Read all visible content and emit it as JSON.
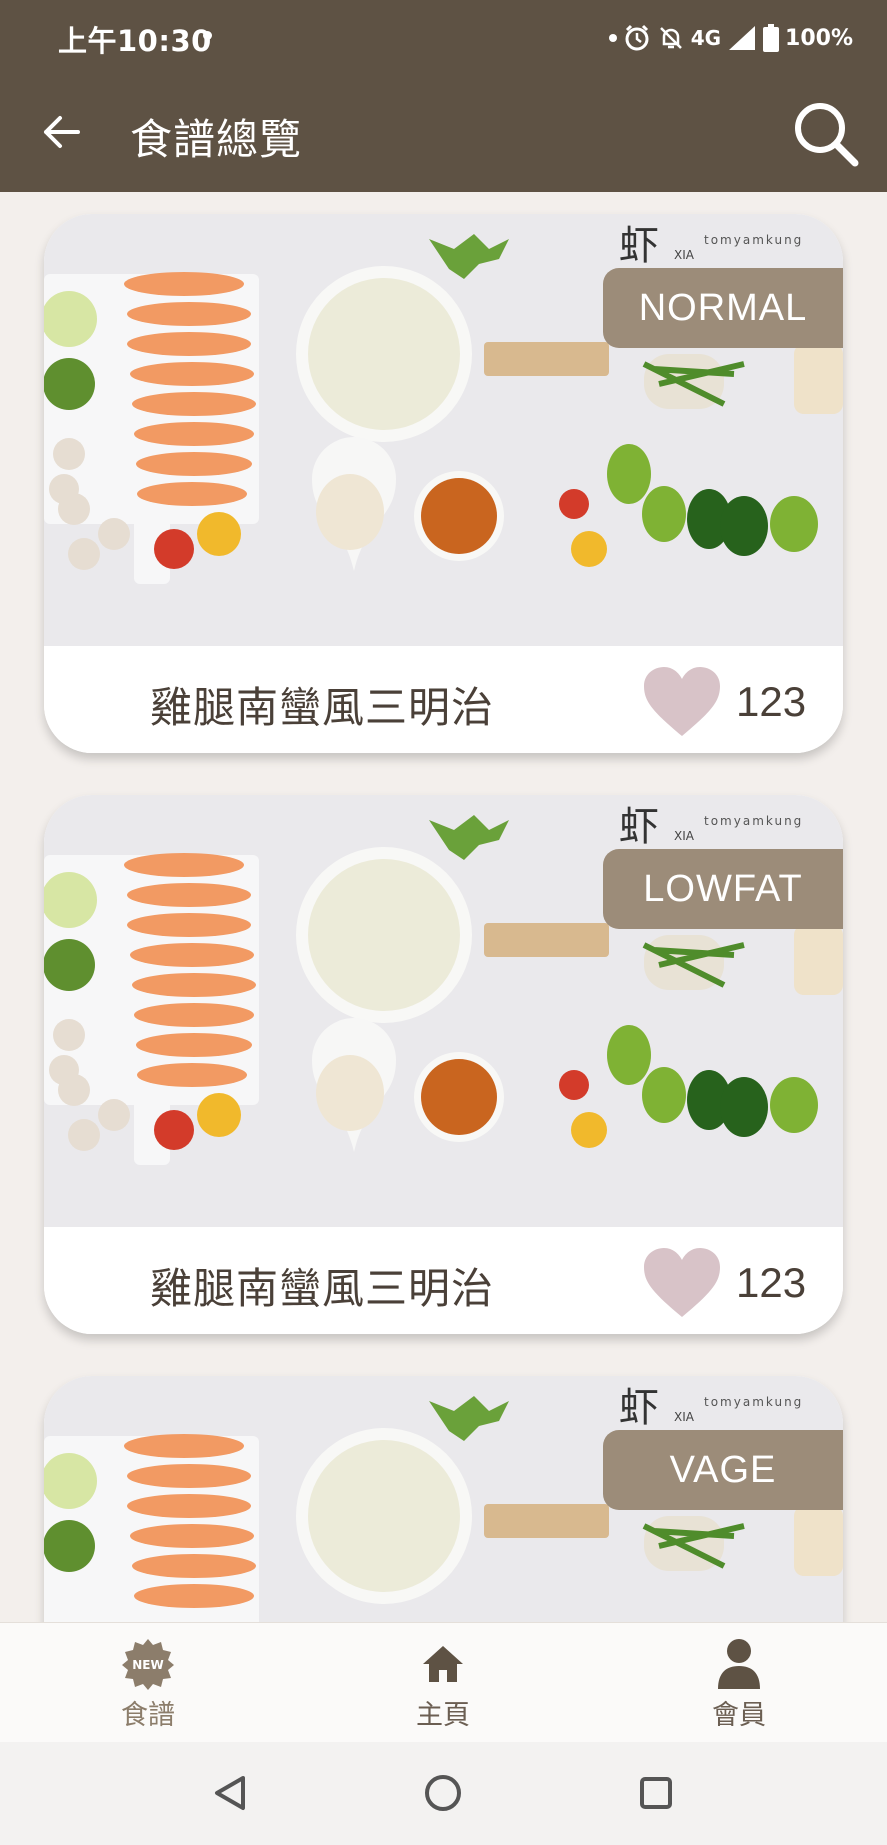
{
  "status_bar": {
    "time": "上午10:30",
    "network": "4G",
    "battery": "100%"
  },
  "app_bar": {
    "title": "食譜總覽",
    "back_icon": "arrow-left-icon",
    "search_icon": "search-icon"
  },
  "recipes": [
    {
      "title": "雞腿南蠻風三明治",
      "tag": "NORMAL",
      "likes": "123"
    },
    {
      "title": "雞腿南蠻風三明治",
      "tag": "LOWFAT",
      "likes": "123"
    },
    {
      "tag": "VAGE"
    }
  ],
  "image_text": {
    "logo_char": "虾",
    "logo_latin": "XIA",
    "brand": "tomyamkung"
  },
  "bottom_nav": {
    "items": [
      {
        "label": "食譜",
        "icon": "new-badge-icon",
        "badge": "NEW"
      },
      {
        "label": "主頁",
        "icon": "home-icon"
      },
      {
        "label": "會員",
        "icon": "person-icon"
      }
    ]
  },
  "colors": {
    "header": "#5e5244",
    "tag": "#9c8c79",
    "heart": "#d8c3c8",
    "background": "#f3efec"
  }
}
